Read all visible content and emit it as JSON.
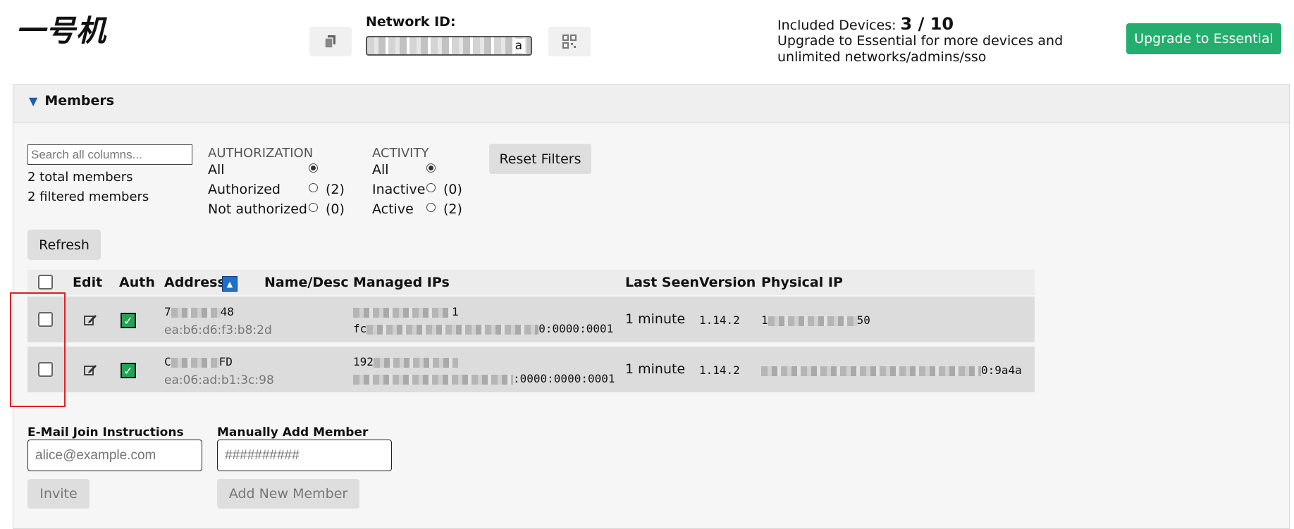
{
  "header": {
    "title": "一号机",
    "network_id_label": "Network ID:",
    "network_id_value_visible": "a",
    "included_label": "Included Devices:",
    "included_value": "3 / 10",
    "upgrade_text": "Upgrade to Essential for more devices and unlimited networks/admins/sso",
    "upgrade_button": "Upgrade to Essential"
  },
  "members": {
    "section_title": "Members",
    "search_placeholder": "Search all columns...",
    "total": "2 total members",
    "filtered": "2 filtered members",
    "authorization": {
      "label": "AUTHORIZATION",
      "options": [
        {
          "label": "All",
          "count": "",
          "selected": true
        },
        {
          "label": "Authorized",
          "count": "(2)",
          "selected": false
        },
        {
          "label": "Not authorized",
          "count": "(0)",
          "selected": false
        }
      ]
    },
    "activity": {
      "label": "ACTIVITY",
      "options": [
        {
          "label": "All",
          "count": "",
          "selected": true
        },
        {
          "label": "Inactive",
          "count": "(0)",
          "selected": false
        },
        {
          "label": "Active",
          "count": "(2)",
          "selected": false
        }
      ]
    },
    "reset_filters": "Reset Filters",
    "refresh": "Refresh",
    "columns": [
      "Edit",
      "Auth",
      "Address",
      "Name/Desc",
      "Managed IPs",
      "Last Seen",
      "Version",
      "Physical IP"
    ],
    "rows": [
      {
        "address_prefix": "7",
        "address_suffix": "48",
        "mac": "ea:b6:d6:f3:b8:2d",
        "ip1_suffix": "1",
        "ip2_prefix": "fc",
        "ip2_suffix": "0:0000:0001",
        "last_seen": "1 minute",
        "version": "1.14.2",
        "physical_prefix": "1",
        "physical_suffix": "50"
      },
      {
        "address_prefix": "C",
        "address_suffix": "FD",
        "mac": "ea:06:ad:b1:3c:98",
        "ip1_suffix": "192",
        "ip2_prefix": "",
        "ip2_suffix": ":0000:0000:0001",
        "last_seen": "1 minute",
        "version": "1.14.2",
        "physical_prefix": "",
        "physical_suffix": "0:9a4a"
      }
    ],
    "email_label": "E-Mail Join Instructions",
    "email_placeholder": "alice@example.com",
    "invite": "Invite",
    "manual_label": "Manually Add Member",
    "manual_placeholder": "##########",
    "add_member": "Add New Member"
  },
  "colors": {
    "accent_green": "#24ae6e",
    "auth_green": "#23a455",
    "highlight_red": "#e02020",
    "sort_blue": "#1f6fc5"
  }
}
